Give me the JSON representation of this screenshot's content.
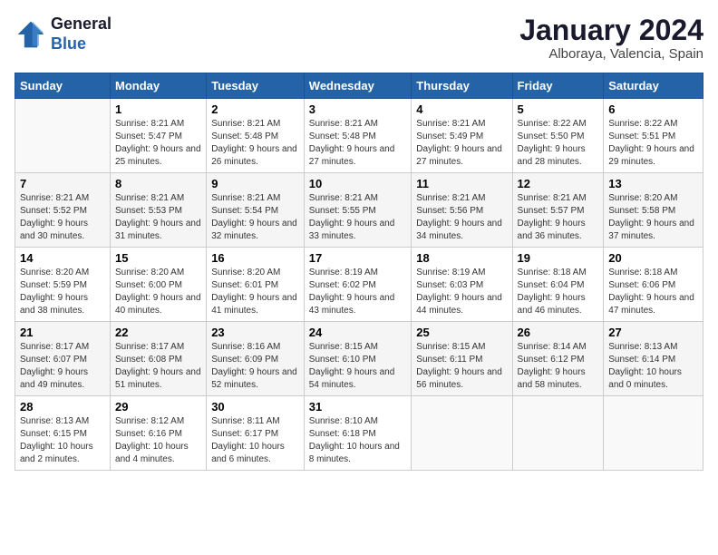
{
  "logo": {
    "line1": "General",
    "line2": "Blue"
  },
  "title": "January 2024",
  "subtitle": "Alboraya, Valencia, Spain",
  "days_header": [
    "Sunday",
    "Monday",
    "Tuesday",
    "Wednesday",
    "Thursday",
    "Friday",
    "Saturday"
  ],
  "weeks": [
    [
      {
        "day": "",
        "sunrise": "",
        "sunset": "",
        "daylight": ""
      },
      {
        "day": "1",
        "sunrise": "Sunrise: 8:21 AM",
        "sunset": "Sunset: 5:47 PM",
        "daylight": "Daylight: 9 hours and 25 minutes."
      },
      {
        "day": "2",
        "sunrise": "Sunrise: 8:21 AM",
        "sunset": "Sunset: 5:48 PM",
        "daylight": "Daylight: 9 hours and 26 minutes."
      },
      {
        "day": "3",
        "sunrise": "Sunrise: 8:21 AM",
        "sunset": "Sunset: 5:48 PM",
        "daylight": "Daylight: 9 hours and 27 minutes."
      },
      {
        "day": "4",
        "sunrise": "Sunrise: 8:21 AM",
        "sunset": "Sunset: 5:49 PM",
        "daylight": "Daylight: 9 hours and 27 minutes."
      },
      {
        "day": "5",
        "sunrise": "Sunrise: 8:22 AM",
        "sunset": "Sunset: 5:50 PM",
        "daylight": "Daylight: 9 hours and 28 minutes."
      },
      {
        "day": "6",
        "sunrise": "Sunrise: 8:22 AM",
        "sunset": "Sunset: 5:51 PM",
        "daylight": "Daylight: 9 hours and 29 minutes."
      }
    ],
    [
      {
        "day": "7",
        "sunrise": "Sunrise: 8:21 AM",
        "sunset": "Sunset: 5:52 PM",
        "daylight": "Daylight: 9 hours and 30 minutes."
      },
      {
        "day": "8",
        "sunrise": "Sunrise: 8:21 AM",
        "sunset": "Sunset: 5:53 PM",
        "daylight": "Daylight: 9 hours and 31 minutes."
      },
      {
        "day": "9",
        "sunrise": "Sunrise: 8:21 AM",
        "sunset": "Sunset: 5:54 PM",
        "daylight": "Daylight: 9 hours and 32 minutes."
      },
      {
        "day": "10",
        "sunrise": "Sunrise: 8:21 AM",
        "sunset": "Sunset: 5:55 PM",
        "daylight": "Daylight: 9 hours and 33 minutes."
      },
      {
        "day": "11",
        "sunrise": "Sunrise: 8:21 AM",
        "sunset": "Sunset: 5:56 PM",
        "daylight": "Daylight: 9 hours and 34 minutes."
      },
      {
        "day": "12",
        "sunrise": "Sunrise: 8:21 AM",
        "sunset": "Sunset: 5:57 PM",
        "daylight": "Daylight: 9 hours and 36 minutes."
      },
      {
        "day": "13",
        "sunrise": "Sunrise: 8:20 AM",
        "sunset": "Sunset: 5:58 PM",
        "daylight": "Daylight: 9 hours and 37 minutes."
      }
    ],
    [
      {
        "day": "14",
        "sunrise": "Sunrise: 8:20 AM",
        "sunset": "Sunset: 5:59 PM",
        "daylight": "Daylight: 9 hours and 38 minutes."
      },
      {
        "day": "15",
        "sunrise": "Sunrise: 8:20 AM",
        "sunset": "Sunset: 6:00 PM",
        "daylight": "Daylight: 9 hours and 40 minutes."
      },
      {
        "day": "16",
        "sunrise": "Sunrise: 8:20 AM",
        "sunset": "Sunset: 6:01 PM",
        "daylight": "Daylight: 9 hours and 41 minutes."
      },
      {
        "day": "17",
        "sunrise": "Sunrise: 8:19 AM",
        "sunset": "Sunset: 6:02 PM",
        "daylight": "Daylight: 9 hours and 43 minutes."
      },
      {
        "day": "18",
        "sunrise": "Sunrise: 8:19 AM",
        "sunset": "Sunset: 6:03 PM",
        "daylight": "Daylight: 9 hours and 44 minutes."
      },
      {
        "day": "19",
        "sunrise": "Sunrise: 8:18 AM",
        "sunset": "Sunset: 6:04 PM",
        "daylight": "Daylight: 9 hours and 46 minutes."
      },
      {
        "day": "20",
        "sunrise": "Sunrise: 8:18 AM",
        "sunset": "Sunset: 6:06 PM",
        "daylight": "Daylight: 9 hours and 47 minutes."
      }
    ],
    [
      {
        "day": "21",
        "sunrise": "Sunrise: 8:17 AM",
        "sunset": "Sunset: 6:07 PM",
        "daylight": "Daylight: 9 hours and 49 minutes."
      },
      {
        "day": "22",
        "sunrise": "Sunrise: 8:17 AM",
        "sunset": "Sunset: 6:08 PM",
        "daylight": "Daylight: 9 hours and 51 minutes."
      },
      {
        "day": "23",
        "sunrise": "Sunrise: 8:16 AM",
        "sunset": "Sunset: 6:09 PM",
        "daylight": "Daylight: 9 hours and 52 minutes."
      },
      {
        "day": "24",
        "sunrise": "Sunrise: 8:15 AM",
        "sunset": "Sunset: 6:10 PM",
        "daylight": "Daylight: 9 hours and 54 minutes."
      },
      {
        "day": "25",
        "sunrise": "Sunrise: 8:15 AM",
        "sunset": "Sunset: 6:11 PM",
        "daylight": "Daylight: 9 hours and 56 minutes."
      },
      {
        "day": "26",
        "sunrise": "Sunrise: 8:14 AM",
        "sunset": "Sunset: 6:12 PM",
        "daylight": "Daylight: 9 hours and 58 minutes."
      },
      {
        "day": "27",
        "sunrise": "Sunrise: 8:13 AM",
        "sunset": "Sunset: 6:14 PM",
        "daylight": "Daylight: 10 hours and 0 minutes."
      }
    ],
    [
      {
        "day": "28",
        "sunrise": "Sunrise: 8:13 AM",
        "sunset": "Sunset: 6:15 PM",
        "daylight": "Daylight: 10 hours and 2 minutes."
      },
      {
        "day": "29",
        "sunrise": "Sunrise: 8:12 AM",
        "sunset": "Sunset: 6:16 PM",
        "daylight": "Daylight: 10 hours and 4 minutes."
      },
      {
        "day": "30",
        "sunrise": "Sunrise: 8:11 AM",
        "sunset": "Sunset: 6:17 PM",
        "daylight": "Daylight: 10 hours and 6 minutes."
      },
      {
        "day": "31",
        "sunrise": "Sunrise: 8:10 AM",
        "sunset": "Sunset: 6:18 PM",
        "daylight": "Daylight: 10 hours and 8 minutes."
      },
      {
        "day": "",
        "sunrise": "",
        "sunset": "",
        "daylight": ""
      },
      {
        "day": "",
        "sunrise": "",
        "sunset": "",
        "daylight": ""
      },
      {
        "day": "",
        "sunrise": "",
        "sunset": "",
        "daylight": ""
      }
    ]
  ]
}
